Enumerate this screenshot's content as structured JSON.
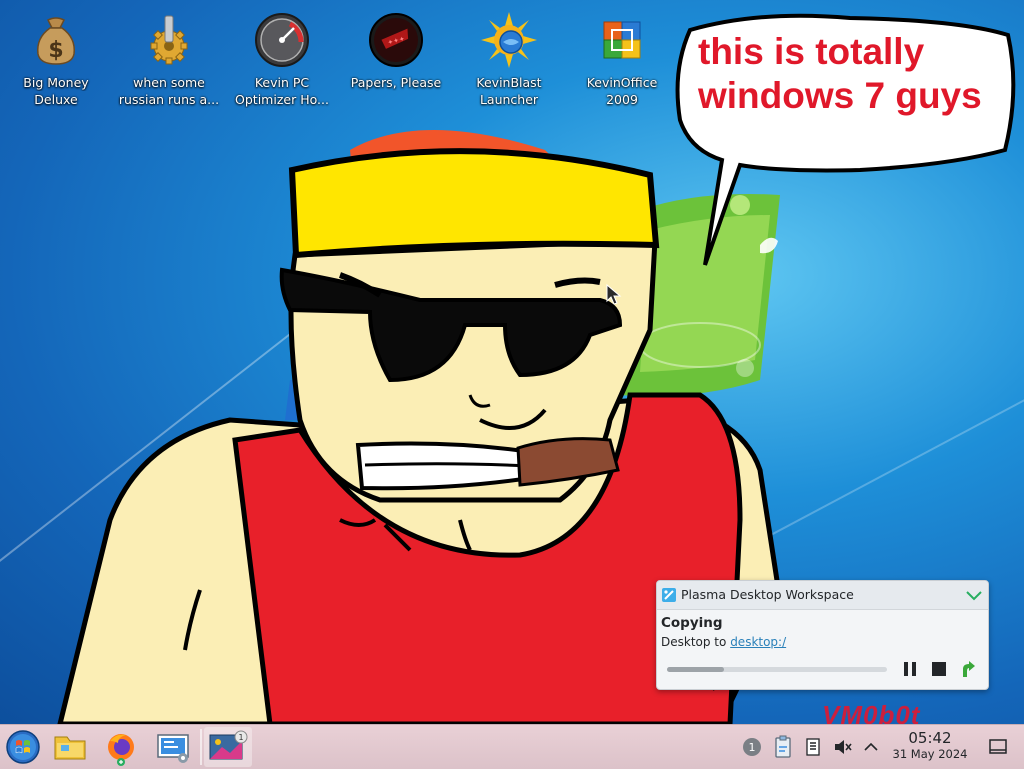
{
  "desktop": {
    "icons": [
      {
        "label_line1": "Big Money",
        "label_line2": "Deluxe",
        "icon": "money-bag-icon"
      },
      {
        "label_line1": "when some",
        "label_line2": "russian runs a...",
        "icon": "gear-icon"
      },
      {
        "label_line1": "Kevin PC",
        "label_line2": "Optimizer Ho...",
        "icon": "speedometer-icon"
      },
      {
        "label_line1": "Papers, Please",
        "label_line2": "",
        "icon": "papers-please-icon"
      },
      {
        "label_line1": "KevinBlast",
        "label_line2": "Launcher",
        "icon": "sun-globe-icon"
      },
      {
        "label_line1": "KevinOffice",
        "label_line2": "2009",
        "icon": "office-icon"
      }
    ],
    "speech_bubble": {
      "line1": "this is totally",
      "line2": "windows 7 guys"
    },
    "watermark": "VM0b0t"
  },
  "notification": {
    "app_name": "Plasma Desktop Workspace",
    "title": "Copying",
    "body_prefix": "Desktop to",
    "body_link": "desktop:/",
    "progress": 0.26
  },
  "taskbar": {
    "apps": [
      "start-menu-icon",
      "file-manager-icon",
      "firefox-icon",
      "system-settings-icon",
      "kde-discover-icon"
    ],
    "active_badge": "1",
    "tray": {
      "notifications_count": "1"
    },
    "clock": {
      "time": "05:42",
      "date": "31 May 2024"
    }
  },
  "colors": {
    "bubble_text": "#e0182a",
    "link": "#2980b9",
    "taskbar": "#e4c9cf"
  }
}
